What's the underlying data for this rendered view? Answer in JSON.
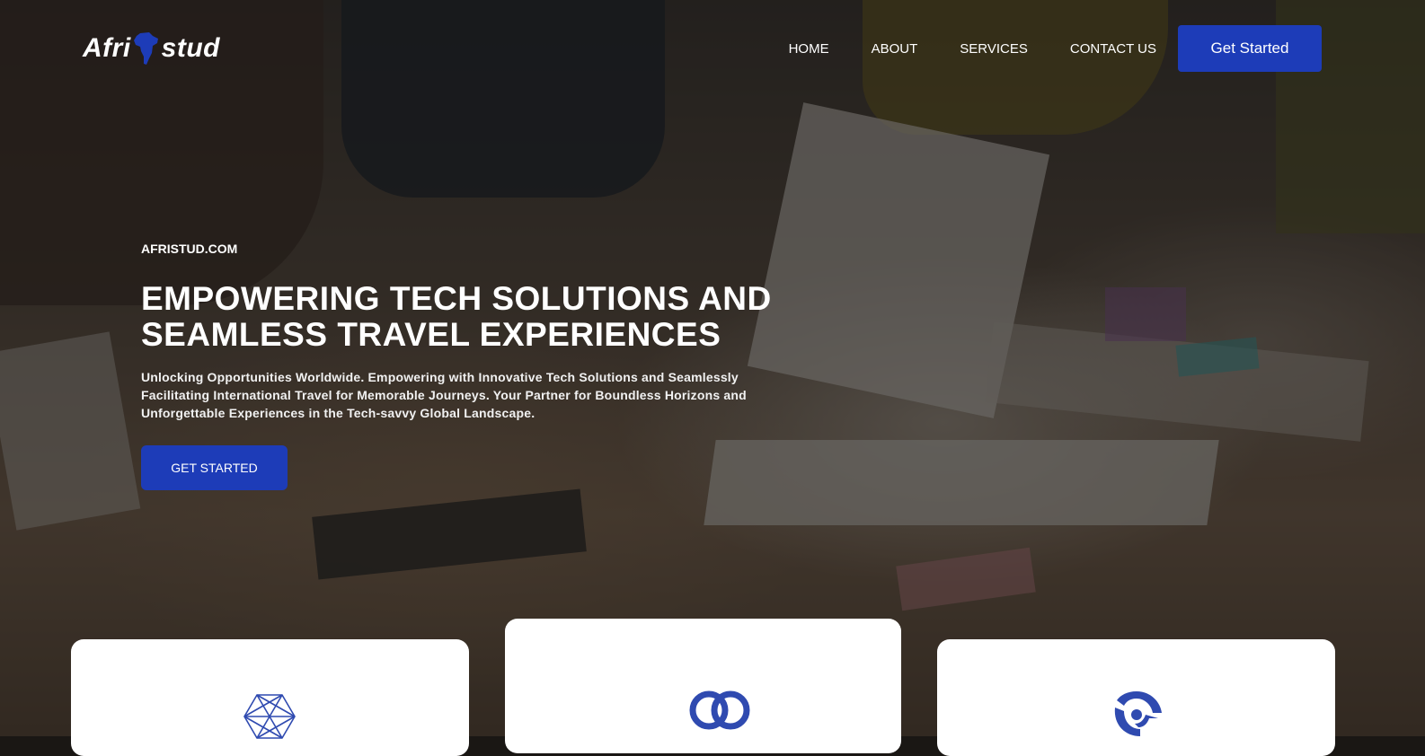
{
  "brand": {
    "name_left": "Afri",
    "name_right": "stud",
    "accent": "#1d3cb8"
  },
  "nav": {
    "items": [
      {
        "label": "HOME"
      },
      {
        "label": "ABOUT"
      },
      {
        "label": "SERVICES"
      },
      {
        "label": "CONTACT US"
      }
    ],
    "cta_label": "Get Started"
  },
  "hero": {
    "eyebrow": "AFRISTUD.COM",
    "title": "EMPOWERING TECH SOLUTIONS AND SEAMLESS TRAVEL EXPERIENCES",
    "subtitle": "Unlocking Opportunities Worldwide. Empowering with Innovative Tech Solutions and Seamlessly Facilitating International Travel for Memorable Journeys. Your Partner for Boundless Horizons and Unforgettable Experiences in the Tech-savvy Global Landscape.",
    "cta_label": "GET STARTED"
  },
  "cards": [
    {
      "icon": "hexagon-mesh-icon"
    },
    {
      "icon": "interlocking-rings-icon"
    },
    {
      "icon": "swirl-icon"
    }
  ]
}
